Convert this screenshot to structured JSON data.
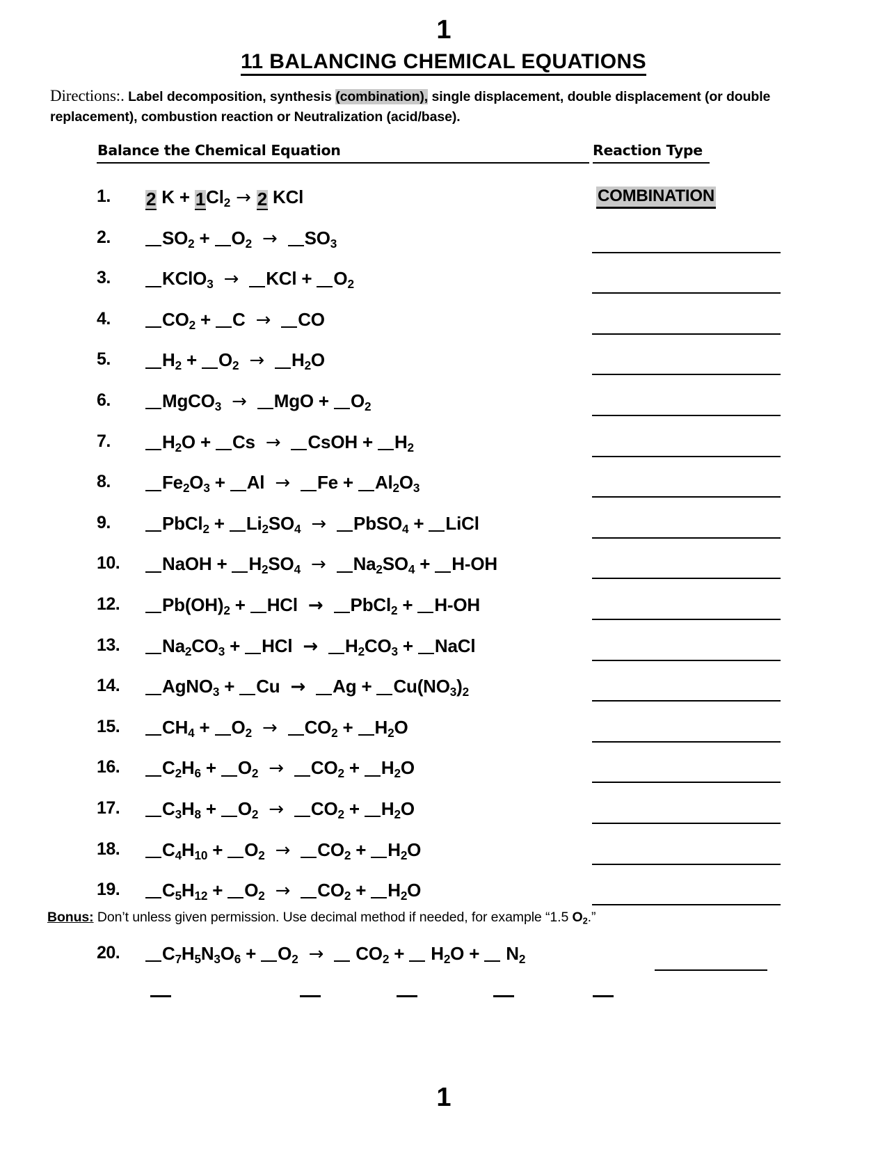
{
  "page": {
    "number_top": "1",
    "number_bottom": "1",
    "title": "11 BALANCING CHEMICAL EQUATIONS"
  },
  "directions": {
    "lead": "Directions:.",
    "text_before_highlight": " Label decomposition, synthesis ",
    "highlight": "(combination),",
    "text_after_highlight": " single displacement, double displacement (or double replacement), combustion reaction or Neutralization (acid/base)."
  },
  "columns": {
    "left_header": "Balance the Chemical Equation",
    "right_header": "Reaction Type"
  },
  "equations": [
    {
      "number": "1.",
      "answer": "COMBINATION",
      "answer_highlighted": true,
      "parts": [
        {
          "t": "blank-filled",
          "v": "2"
        },
        {
          "t": "text",
          "v": " K "
        },
        {
          "t": "text",
          "v": "+ "
        },
        {
          "t": "blank-filled",
          "v": "1"
        },
        {
          "t": "formula",
          "v": "Cl2"
        },
        {
          "t": "arrow",
          "v": "→"
        },
        {
          "t": "blank-filled",
          "v": "2"
        },
        {
          "t": "text",
          "v": " KCl"
        }
      ]
    },
    {
      "number": "2.",
      "answer": "",
      "text": "__SO2 + __O2 → __SO3"
    },
    {
      "number": "3.",
      "answer": "",
      "text": "__KClO3 → __KCl + __O2"
    },
    {
      "number": "4.",
      "answer": "",
      "text": "__CO2 + __C → __CO"
    },
    {
      "number": "5.",
      "answer": "",
      "text": "__H2 + __O2 → __H2O"
    },
    {
      "number": "6.",
      "answer": "",
      "text": "__MgCO3 → __MgO + __O2"
    },
    {
      "number": "7.",
      "answer": "",
      "text": "__H2O + __Cs → __CsOH + __H2"
    },
    {
      "number": "8.",
      "answer": "",
      "text": "__Fe2O3 + __Al → __Fe + __Al2O3"
    },
    {
      "number": "9.",
      "answer": "",
      "text": "__PbCl2 + __Li2SO4 → __PbSO4 + __LiCl"
    },
    {
      "number": "10.",
      "answer": "",
      "text": "__NaOH + __H2SO4 → __Na2SO4 + __H-OH"
    },
    {
      "number": "12.",
      "answer": "",
      "text": "__Pb(OH)2 + __HCl → __PbCl2 + __H-OH"
    },
    {
      "number": "13.",
      "answer": "",
      "text": "__Na2CO3 + __HCl → __H2CO3 + __NaCl"
    },
    {
      "number": "14.",
      "answer": "",
      "text": "__AgNO3 + __Cu → __Ag + __Cu(NO3)2"
    },
    {
      "number": "15.",
      "answer": "",
      "text": "__CH4 + __O2 → __CO2 + __H2O"
    },
    {
      "number": "16.",
      "answer": "",
      "text": "__C2H6 + __O2 → __CO2 + __H2O"
    },
    {
      "number": "17.",
      "answer": "",
      "text": "__C3H8 + __O2 → __CO2 + __H2O"
    },
    {
      "number": "18.",
      "answer": "",
      "text": "__C4H10 + __O2 → __CO2 + __H2O"
    },
    {
      "number": "19.",
      "answer": "",
      "text": "__C5H12 + __O2 → __CO2 + __H2O"
    }
  ],
  "bonus": {
    "label": "Bonus:",
    "text_before_formula": " Don’t unless given permission. Use decimal method if needed, for example “1.5 ",
    "formula": "O2",
    "text_after_formula": ".”"
  },
  "item20": {
    "number": "20.",
    "text": "__C7H5N3O6 + __O2 → __ CO2 + __ H2O + __ N2"
  },
  "stray_blanks": {
    "count": 5,
    "positions": [
      216,
      431,
      570,
      709,
      852
    ]
  },
  "colors": {
    "highlight": "#c9c9c9",
    "ink": "#000000",
    "paper": "#ffffff"
  }
}
